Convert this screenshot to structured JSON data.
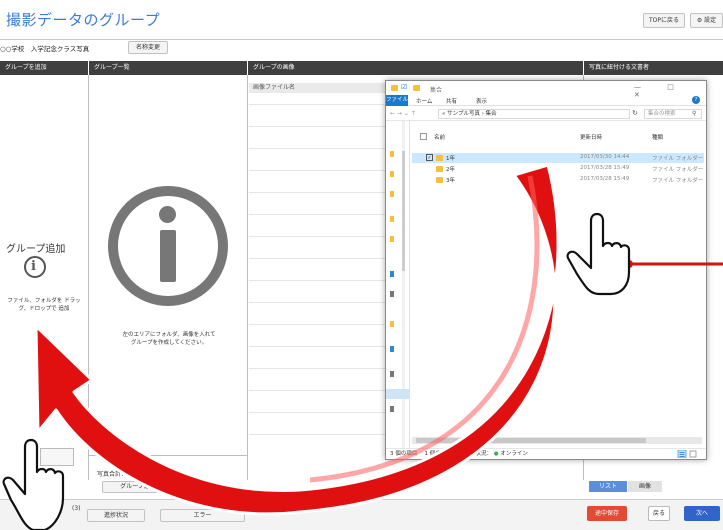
{
  "header": {
    "title": "撮影データのグループ",
    "top_button": "TOPに戻る",
    "settings_button": "設定"
  },
  "subheader": {
    "school": "○○学校　入学記念クラス写真",
    "rename_button": "名称変更"
  },
  "columns": {
    "add_group": "グループを追加",
    "group_list": "グループ一覧",
    "group_images": "グループの画像",
    "linked_docs": "写真に紐付ける文書者"
  },
  "left_panel": {
    "title": "グループ追加",
    "description": "ファイル、フォルダを ドラッグ、ドロップで 追加"
  },
  "center_panel": {
    "description_line1": "左のエリアにフォルダ、画像を入れて",
    "description_line2": "グループを作成してください。"
  },
  "images_panel": {
    "column_header": "画像ファイル名"
  },
  "bottom": {
    "photo_total_label": "写真合計",
    "photo_total_value": "0枚",
    "group_add_button": "グループ追加",
    "left_step": "(3)",
    "progress_button": "進捗状況",
    "error_button": "エラー",
    "list_button": "リスト",
    "image_button": "画像",
    "save_button": "途中保存",
    "back_button": "戻る",
    "next_button": "次へ"
  },
  "explorer": {
    "title": "集合",
    "window_buttons": "— □ ✕",
    "ribbon_tabs": [
      "ファイル",
      "ホーム",
      "共有",
      "表示"
    ],
    "path": "« サンプル写真 › 集合",
    "search_placeholder": "集合の検索",
    "col_name": "名前",
    "col_modified": "更新日時",
    "col_type": "種類",
    "rows": [
      {
        "name": "1年",
        "modified": "2017/03/30 14:44",
        "type": "ファイル フォルダー",
        "selected": true
      },
      {
        "name": "2年",
        "modified": "2017/03/28 15:49",
        "type": "ファイル フォルダー",
        "selected": false
      },
      {
        "name": "3年",
        "modified": "2017/03/28 15:49",
        "type": "ファイル フォルダー",
        "selected": false
      }
    ],
    "status_items": "3 個の項目",
    "status_selected": "1 個の項目を選択",
    "status_state": "状況",
    "status_online": "オンライン"
  },
  "colors": {
    "accent_blue": "#3a7bd5",
    "header_dark": "#3f3f3f",
    "arrow_red": "#e01010",
    "save_red": "#e24a32",
    "next_blue": "#2f64c9"
  },
  "icons": [
    "gear-icon",
    "info-icon",
    "folder-icon",
    "search-icon",
    "refresh-icon",
    "online-icon",
    "hand-cursor-icon",
    "curved-arrow-icon"
  ]
}
